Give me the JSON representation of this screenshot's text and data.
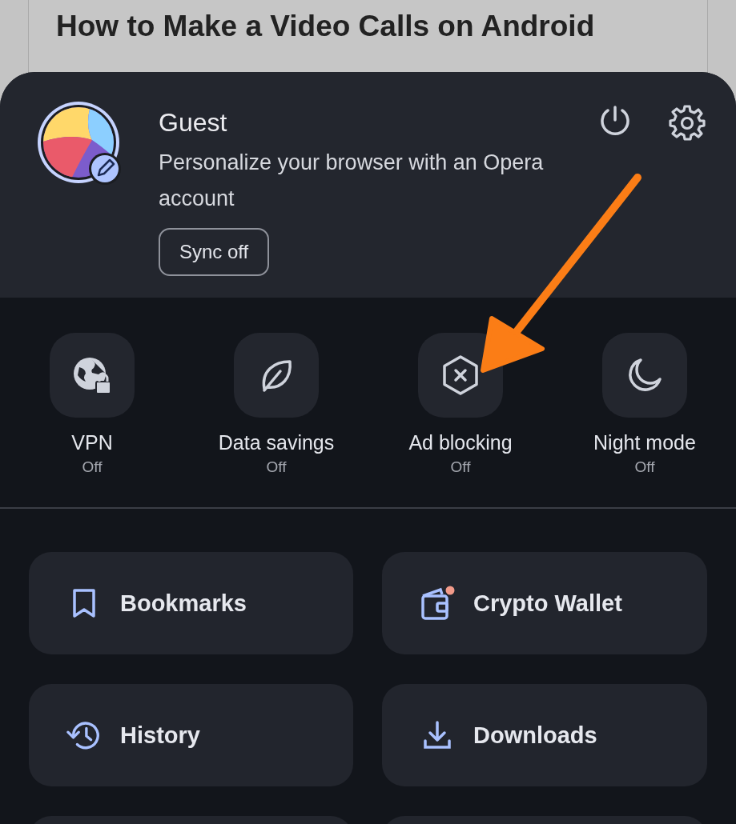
{
  "article": {
    "title": "How to Make a Video Calls on Android"
  },
  "profile": {
    "name": "Guest",
    "description": "Personalize your browser with an Opera account",
    "sync_button": "Sync off"
  },
  "quick_toggles": [
    {
      "label": "VPN",
      "status": "Off"
    },
    {
      "label": "Data savings",
      "status": "Off"
    },
    {
      "label": "Ad blocking",
      "status": "Off"
    },
    {
      "label": "Night mode",
      "status": "Off"
    }
  ],
  "menu_items": [
    {
      "label": "Bookmarks"
    },
    {
      "label": "Crypto Wallet"
    },
    {
      "label": "History"
    },
    {
      "label": "Downloads"
    }
  ]
}
